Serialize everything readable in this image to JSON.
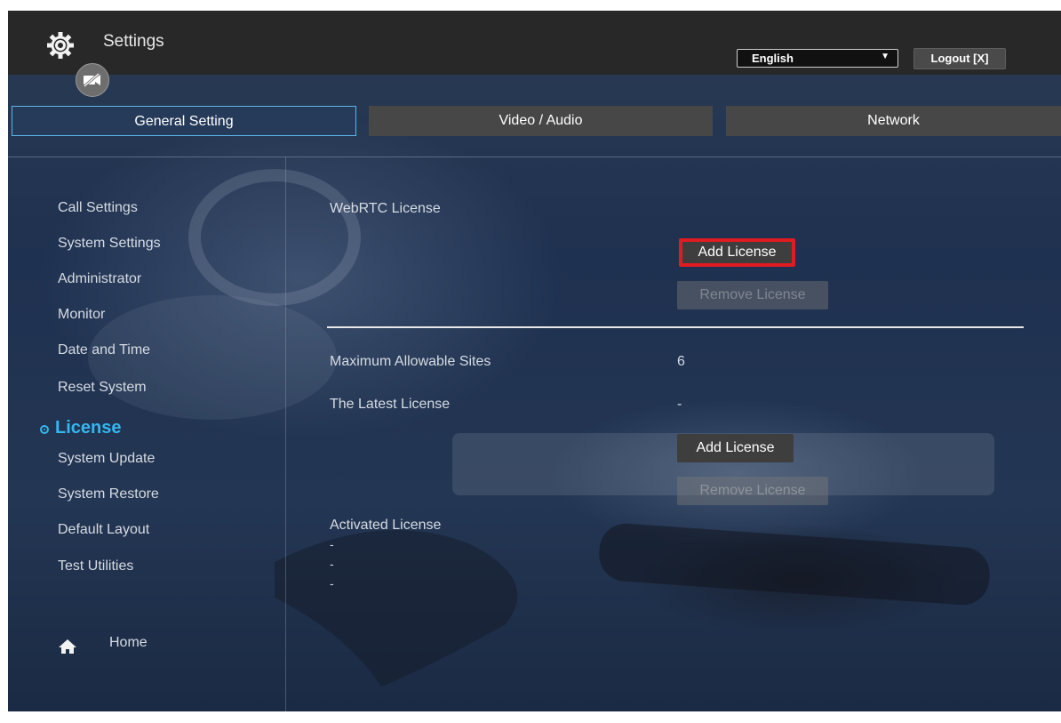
{
  "header": {
    "title": "Settings",
    "gear_icon": "gear-icon",
    "camera_icon": "camera-off-icon",
    "language": {
      "selected": "English",
      "options": [
        "English"
      ]
    },
    "logout_label": "Logout [X]"
  },
  "tabs": [
    {
      "label": "General Setting",
      "active": true
    },
    {
      "label": "Video / Audio",
      "active": false
    },
    {
      "label": "Network",
      "active": false
    }
  ],
  "sidebar": {
    "items": [
      {
        "label": "Call Settings"
      },
      {
        "label": "System Settings"
      },
      {
        "label": "Administrator"
      },
      {
        "label": "Monitor"
      },
      {
        "label": "Date and Time"
      },
      {
        "label": "Reset System"
      },
      {
        "label": "License",
        "active": true
      },
      {
        "label": "System Update"
      },
      {
        "label": "System Restore"
      },
      {
        "label": "Default Layout"
      },
      {
        "label": "Test Utilities"
      }
    ],
    "home_label": "Home"
  },
  "main": {
    "webrtc_title": "WebRTC License",
    "add_license_1": "Add License",
    "remove_license_1": "Remove License",
    "max_sites_label": "Maximum Allowable Sites",
    "max_sites_value": "6",
    "latest_license_label": "The Latest License",
    "latest_license_value": "-",
    "add_license_2": "Add License",
    "remove_license_2": "Remove License",
    "activated_license_label": "Activated License",
    "activated_list": [
      "-",
      "-",
      "-"
    ]
  },
  "colors": {
    "accent": "#35b6f0",
    "highlight_border": "#e01b22",
    "topbar": "#282828"
  }
}
